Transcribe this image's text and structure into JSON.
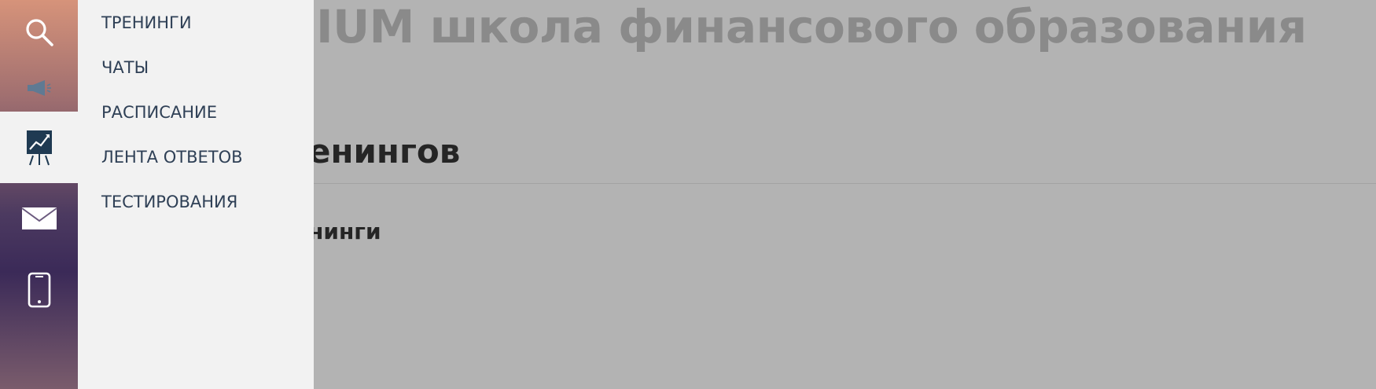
{
  "background": {
    "title": "IUM школа финансового образования",
    "heading": "енингов",
    "subheading": "нинги"
  },
  "rail": {
    "items": [
      {
        "name": "search",
        "icon": "search-icon"
      },
      {
        "name": "announcements",
        "icon": "megaphone-icon"
      },
      {
        "name": "trainings",
        "icon": "chart-board-icon",
        "active": true
      },
      {
        "name": "mail",
        "icon": "mail-icon"
      },
      {
        "name": "mobile",
        "icon": "phone-icon"
      }
    ]
  },
  "menu": {
    "items": [
      {
        "label": "ТРЕНИНГИ"
      },
      {
        "label": "ЧАТЫ"
      },
      {
        "label": "РАСПИСАНИЕ"
      },
      {
        "label": "ЛЕНТА ОТВЕТОВ"
      },
      {
        "label": "ТЕСТИРОВАНИЯ"
      }
    ]
  },
  "colors": {
    "menu_text": "#2f4056",
    "panel_bg": "#f2f2f2",
    "overlay_bg": "#b3b3b3",
    "heading_text": "#252525",
    "title_text": "#8a8a8a"
  }
}
